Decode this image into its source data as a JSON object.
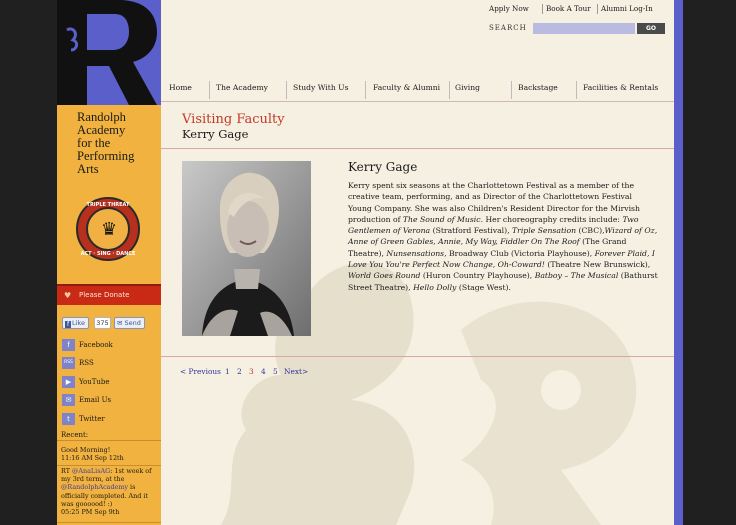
{
  "brand": {
    "name_lines": [
      "Randolph",
      "Academy",
      "for the",
      "Performing",
      "Arts"
    ],
    "badge_top": "TRIPLE THREAT",
    "badge_bottom": "ACT · SING · DANCE",
    "colors": {
      "purple": "#5a5fc9",
      "gold": "#f1b23f",
      "red": "#c82a16",
      "cream": "#f5f0e1"
    }
  },
  "top_links": [
    "Apply Now",
    "Book A Tour",
    "Alumni Log-In"
  ],
  "search": {
    "label": "SEARCH",
    "button": "GO",
    "placeholder": ""
  },
  "nav": [
    "Home",
    "The Academy",
    "Study With Us",
    "Faculty & Alumni",
    "Giving",
    "Backstage",
    "Facilities & Rentals"
  ],
  "sidebar": {
    "donate": "Please Donate",
    "facebook": {
      "like": "Like",
      "count": "375",
      "send": "Send"
    },
    "social": [
      {
        "label": "Facebook",
        "icon": "facebook-icon",
        "glyph": "f"
      },
      {
        "label": "RSS",
        "icon": "rss-icon",
        "glyph": "RSS"
      },
      {
        "label": "YouTube",
        "icon": "youtube-icon",
        "glyph": "▶"
      },
      {
        "label": "Email Us",
        "icon": "email-icon",
        "glyph": "✉"
      },
      {
        "label": "Twitter",
        "icon": "twitter-icon",
        "glyph": "t"
      }
    ],
    "recent_label": "Recent:",
    "tweets": [
      {
        "text": "Good Morning!",
        "time": "11:16 AM Sep 12th"
      },
      {
        "prefix": "RT ",
        "handle1": "@AnaLisAG",
        "mid": ": 1st week of my 3rd term, at the ",
        "handle2": "@RandolphAcademy",
        "rest": " is officially completed. And it was goooood! :)",
        "time": "05:25 PM Sep 9th"
      }
    ]
  },
  "page": {
    "section": "Visiting Faculty",
    "title": "Kerry Gage",
    "bio_name": "Kerry Gage",
    "bio": [
      {
        "t": "Kerry spent six seasons at the Charlottetown Festival as a member of the creative team, performing, and as Director of the Charlottetown Festival Young Company. She was also Children's Resident Director for the Mirvish production of "
      },
      {
        "t": "The Sound of Music",
        "i": true
      },
      {
        "t": ". Her choreography credits include: "
      },
      {
        "t": "Two Gentlemen of Verona",
        "i": true
      },
      {
        "t": " (Stratford Festival), "
      },
      {
        "t": "Triple Sensation",
        "i": true
      },
      {
        "t": " (CBC),"
      },
      {
        "t": "Wizard of Oz, Anne of Green Gables, Annie, My Way, Fiddler On The Roof",
        "i": true
      },
      {
        "t": " (The Grand Theatre), "
      },
      {
        "t": "Nunsensations",
        "i": true
      },
      {
        "t": ", Broadway Club (Victoria Playhouse), "
      },
      {
        "t": "Forever Plaid, I Love You You're Perfect Now Change, Oh-Coward!",
        "i": true
      },
      {
        "t": " (Theatre New Brunswick), "
      },
      {
        "t": "World Goes Round",
        "i": true
      },
      {
        "t": " (Huron Country Playhouse), "
      },
      {
        "t": "Batboy – The Musical",
        "i": true
      },
      {
        "t": " (Bathurst Street Theatre), "
      },
      {
        "t": "Hello Dolly",
        "i": true
      },
      {
        "t": " (Stage West)."
      }
    ]
  },
  "pagination": {
    "prev": "< Previous",
    "pages": [
      "1",
      "2",
      "3",
      "4",
      "5"
    ],
    "current": "3",
    "next": "Next>"
  }
}
